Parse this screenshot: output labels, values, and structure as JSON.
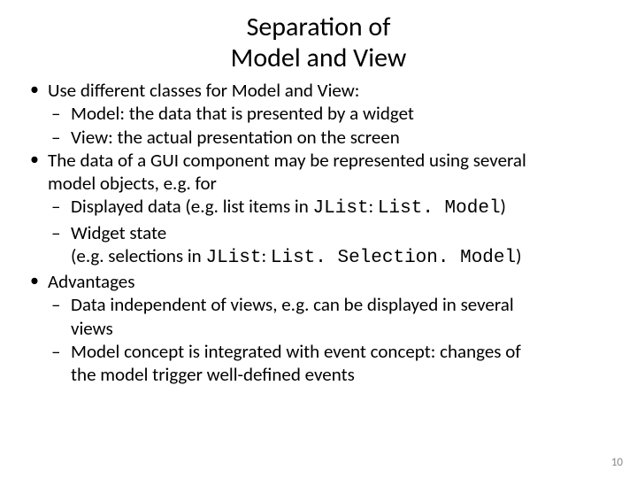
{
  "title_line1": "Separation of",
  "title_line2": "Model and View",
  "b1": "Use different classes for Model and View:",
  "b1_1": "Model: the data that is presented by a widget",
  "b1_2": "View: the actual presentation on the screen",
  "b2a": "The data of a GUI component may be represented using several",
  "b2b": "model objects, e.g. for",
  "b2_1_pre": "Displayed data (e.g. list items in ",
  "b2_1_code1": "JList",
  "b2_1_mid": ": ",
  "b2_1_code2": "List. Model",
  "b2_1_post": ")",
  "b2_2a": "Widget state",
  "b2_2b_pre": "(e.g. selections in ",
  "b2_2b_code1": "JList",
  "b2_2b_mid": ": ",
  "b2_2b_code2": "List. Selection. Model",
  "b2_2b_post": ")",
  "b3": "Advantages",
  "b3_1a": "Data independent of views, e.g. can be displayed in several",
  "b3_1b": "views",
  "b3_2a": "Model concept is integrated with event concept: changes of",
  "b3_2b": "the model trigger well-defined events",
  "page_number": "10"
}
